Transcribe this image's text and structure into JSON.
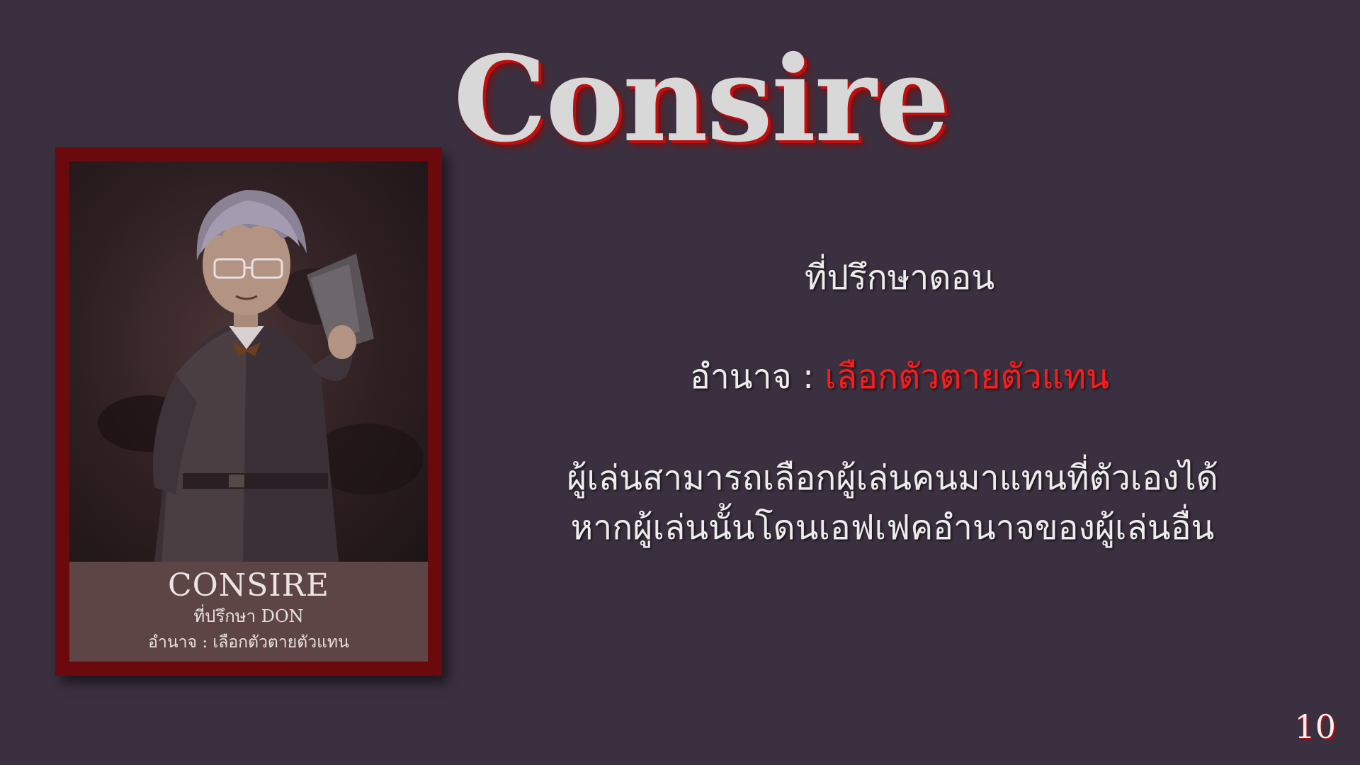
{
  "slide": {
    "title": "Consire",
    "role": "ที่ปรึกษาดอน",
    "power_label": "อำนาจ : ",
    "power_value": "เลือกตัวตายตัวแทน",
    "description_line1": "ผู้เล่นสามารถเลือกผู้เล่นคนมาแทนที่ตัวเองได้",
    "description_line2": "หากผู้เล่นนั้นโดนเอฟเฟคอำนาจของผู้เล่นอื่น",
    "page_number": "10"
  },
  "card": {
    "name": "CONSIRE",
    "role": "ที่ปรึกษา DON",
    "power": "อำนาจ : เลือกตัวตายตัวแทน"
  },
  "colors": {
    "background": "#3b303f",
    "accent_red": "#ff1b1b",
    "card_frame": "#6a0a0d"
  }
}
